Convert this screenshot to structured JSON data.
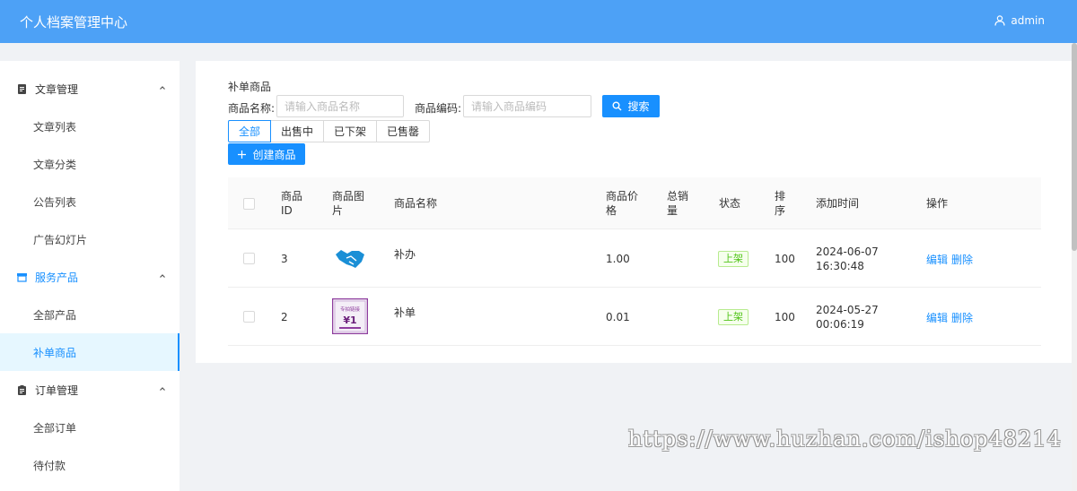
{
  "header": {
    "title": "个人档案管理中心",
    "user": "admin"
  },
  "sidebar": {
    "groups": [
      {
        "label": "文章管理",
        "icon": "document-icon",
        "items": [
          "文章列表",
          "文章分类",
          "公告列表",
          "广告幻灯片"
        ]
      },
      {
        "label": "服务产品",
        "icon": "shop-icon",
        "items": [
          "全部产品",
          "补单商品"
        ]
      },
      {
        "label": "订单管理",
        "icon": "clipboard-icon",
        "items": [
          "全部订单",
          "待付款"
        ]
      }
    ],
    "active_item": "补单商品"
  },
  "main": {
    "heading": "补单商品",
    "filters": {
      "name_label": "商品名称:",
      "name_placeholder": "请输入商品名称",
      "code_label": "商品编码:",
      "code_placeholder": "请输入商品编码",
      "search_label": "搜索"
    },
    "tabs": [
      "全部",
      "出售中",
      "已下架",
      "已售罄"
    ],
    "active_tab": "全部",
    "create_label": "创建商品",
    "table": {
      "headers": {
        "id_line1": "商品",
        "id_line2": "ID",
        "image_line1": "商品图",
        "image_line2": "片",
        "name": "商品名称",
        "price_line1": "商品价",
        "price_line2": "格",
        "sales_line1": "总销",
        "sales_line2": "量",
        "status": "状态",
        "sort_line1": "排",
        "sort_line2": "序",
        "time": "添加时间",
        "actions": "操作"
      },
      "rows": [
        {
          "id": "3",
          "name": "补办",
          "price": "1.00",
          "status": "上架",
          "sort": "100",
          "date": "2024-06-07",
          "time": "16:30:48",
          "edit": "编辑",
          "delete": "删除",
          "image": "handshake-icon"
        },
        {
          "id": "2",
          "name": "补单",
          "price": "0.01",
          "status": "上架",
          "sort": "100",
          "date": "2024-05-27",
          "time": "00:06:19",
          "edit": "编辑",
          "delete": "删除",
          "image": "promo-card-image",
          "image_text_top": "专拍链接",
          "image_text_big": "¥1"
        }
      ]
    }
  },
  "watermark": "https://www.huzhan.com/ishop48214",
  "colors": {
    "header": "#4da1f6",
    "primary": "#1890ff",
    "status_green": "#52c41a"
  }
}
